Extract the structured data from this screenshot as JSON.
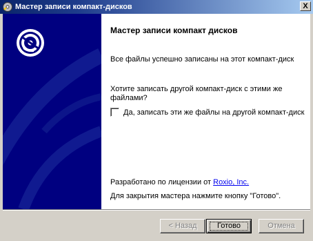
{
  "window": {
    "title": "Мастер записи компакт-дисков",
    "close_label": "X"
  },
  "content": {
    "heading": "Мастер записи компакт дисков",
    "message": "Все файлы успешно записаны на этот компакт-диск",
    "question": "Хотите записать другой компакт-диск с этими же файлами?",
    "checkbox_label": "Да, записать эти же файлы на другой компакт-диск",
    "checkbox_checked": false,
    "license_prefix": "Разработано по лицензии от ",
    "license_link": "Roxio, Inc.",
    "closing": "Для закрытия мастера нажмите кнопку \"Готово\"."
  },
  "buttons": {
    "back": "< Назад",
    "finish": "Готово",
    "cancel": "Отмена"
  },
  "colors": {
    "banner": "#000080",
    "titlebar_start": "#0a246a",
    "titlebar_end": "#a6caf0"
  }
}
